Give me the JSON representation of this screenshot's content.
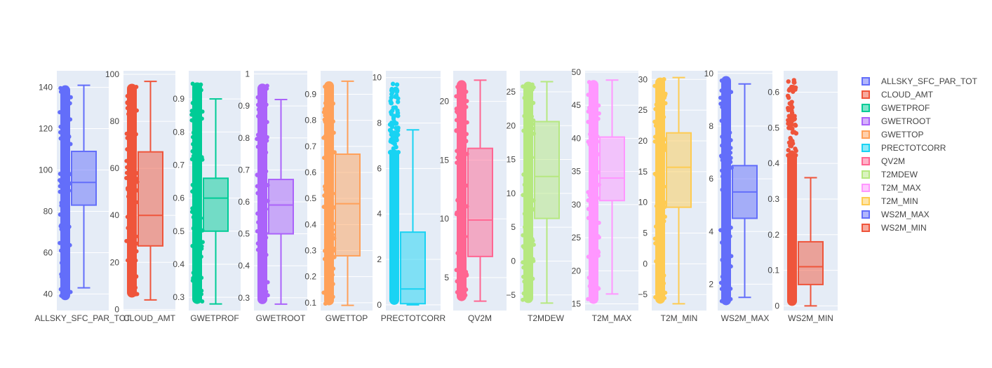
{
  "chart_data": {
    "type": "box",
    "grid": true,
    "legend_position": "right",
    "series": [
      {
        "name": "ALLSKY_SFC_PAR_TOT",
        "category": "ALLSKY_SFC_PAR_TOT",
        "color": "#636efa",
        "ylim": [
          32,
          148
        ],
        "ticks": [
          40,
          60,
          80,
          100,
          120,
          140
        ],
        "tick_labels": [
          "40",
          "60",
          "80",
          "100",
          "120",
          "140"
        ],
        "points_range": [
          37,
          141
        ],
        "points_density": "dense",
        "min": 43,
        "q1": 83,
        "median": 94,
        "q3": 109,
        "max": 141
      },
      {
        "name": "CLOUD_AMT",
        "category": "CLOUD_AMT",
        "color": "#ef553b",
        "ylim": [
          -0.5,
          101.5
        ],
        "ticks": [
          0,
          20,
          40,
          60,
          80,
          100
        ],
        "tick_labels": [
          "0",
          "20",
          "40",
          "60",
          "80",
          "100"
        ],
        "points_range": [
          5,
          96
        ],
        "points_density": "dense",
        "min": 4,
        "q1": 27,
        "median": 40,
        "q3": 67,
        "max": 97
      },
      {
        "name": "GWETPROF",
        "category": "GWETPROF",
        "color": "#00cc96",
        "ylim": [
          0.26,
          0.985
        ],
        "ticks": [
          0.3,
          0.4,
          0.5,
          0.6,
          0.7,
          0.8,
          0.9
        ],
        "tick_labels": [
          "0.3",
          "0.4",
          "0.5",
          "0.6",
          "0.7",
          "0.8",
          "0.9"
        ],
        "points_range": [
          0.28,
          0.95
        ],
        "points_density": "dense",
        "min": 0.28,
        "q1": 0.5,
        "median": 0.6,
        "q3": 0.66,
        "max": 0.9
      },
      {
        "name": "GWETROOT",
        "category": "GWETROOT",
        "color": "#ab63fa",
        "ylim": [
          0.26,
          1.01
        ],
        "ticks": [
          0.3,
          0.4,
          0.5,
          0.6,
          0.7,
          0.8,
          0.9,
          1
        ],
        "tick_labels": [
          "0.3",
          "0.4",
          "0.5",
          "0.6",
          "0.7",
          "0.8",
          "0.9",
          "1"
        ],
        "points_range": [
          0.28,
          0.97
        ],
        "points_density": "dense",
        "min": 0.28,
        "q1": 0.5,
        "median": 0.59,
        "q3": 0.67,
        "max": 0.92
      },
      {
        "name": "GWETTOP",
        "category": "GWETTOP",
        "color": "#ffa15a",
        "ylim": [
          0.07,
          0.99
        ],
        "ticks": [
          0.1,
          0.2,
          0.3,
          0.4,
          0.5,
          0.6,
          0.7,
          0.8,
          0.9
        ],
        "tick_labels": [
          "0.1",
          "0.2",
          "0.3",
          "0.4",
          "0.5",
          "0.6",
          "0.7",
          "0.8",
          "0.9"
        ],
        "points_range": [
          0.09,
          0.95
        ],
        "points_density": "dense",
        "min": 0.09,
        "q1": 0.28,
        "median": 0.48,
        "q3": 0.67,
        "max": 0.95
      },
      {
        "name": "PRECTOTCORR",
        "category": "PRECTOTCORR",
        "color": "#19d3f3",
        "ylim": [
          -0.25,
          10.3
        ],
        "ticks": [
          0,
          2,
          4,
          6,
          8,
          10
        ],
        "tick_labels": [
          "0",
          "2",
          "4",
          "6",
          "8",
          "10"
        ],
        "points_range": [
          0,
          9.8
        ],
        "points_density": "sparse-top",
        "min": 0,
        "q1": 0.05,
        "median": 0.7,
        "q3": 3.2,
        "max": 7.7
      },
      {
        "name": "QV2M",
        "category": "QV2M",
        "color": "#ff6692",
        "ylim": [
          2.2,
          22.6
        ],
        "ticks": [
          5,
          10,
          15,
          20
        ],
        "tick_labels": [
          "5",
          "10",
          "15",
          "20"
        ],
        "points_range": [
          3,
          21.8
        ],
        "points_density": "dense",
        "min": 3,
        "q1": 6.8,
        "median": 9.9,
        "q3": 16,
        "max": 21.8
      },
      {
        "name": "T2MDEW",
        "category": "T2MDEW",
        "color": "#b6e880",
        "ylim": [
          -7.3,
          28.1
        ],
        "ticks": [
          -5,
          0,
          5,
          10,
          15,
          20,
          25
        ],
        "tick_labels": [
          "−5",
          "0",
          "5",
          "10",
          "15",
          "20",
          "25"
        ],
        "points_range": [
          -6.2,
          26.5
        ],
        "points_density": "dense",
        "min": -6.2,
        "q1": 6.3,
        "median": 12.5,
        "q3": 20.6,
        "max": 26.5
      },
      {
        "name": "T2M_MAX",
        "category": "T2M_MAX",
        "color": "#ff97ff",
        "ylim": [
          14,
          50.2
        ],
        "ticks": [
          15,
          20,
          25,
          30,
          35,
          40,
          45,
          50
        ],
        "tick_labels": [
          "15",
          "20",
          "25",
          "30",
          "35",
          "40",
          "45",
          "50"
        ],
        "points_range": [
          15,
          48.8
        ],
        "points_density": "dense",
        "min": 16.5,
        "q1": 30.6,
        "median": 34,
        "q3": 40.2,
        "max": 48.8
      },
      {
        "name": "T2M_MIN",
        "category": "T2M_MIN",
        "color": "#fecb52",
        "ylim": [
          -7.6,
          31.4
        ],
        "ticks": [
          -5,
          0,
          5,
          10,
          15,
          20,
          25,
          30
        ],
        "tick_labels": [
          "−5",
          "0",
          "5",
          "10",
          "15",
          "20",
          "25",
          "30"
        ],
        "points_range": [
          -6.5,
          30.3
        ],
        "points_density": "dense",
        "min": -6.5,
        "q1": 9.2,
        "median": 15.7,
        "q3": 21.3,
        "max": 30.3
      },
      {
        "name": "WS2M_MAX",
        "category": "WS2M_MAX",
        "color": "#636efa",
        "ylim": [
          1,
          10.1
        ],
        "ticks": [
          2,
          4,
          6,
          8,
          10
        ],
        "tick_labels": [
          "2",
          "4",
          "6",
          "8",
          "10"
        ],
        "points_range": [
          1.2,
          9.9
        ],
        "points_density": "dense",
        "min": 1.5,
        "q1": 4.5,
        "median": 5.5,
        "q3": 6.5,
        "max": 9.6
      },
      {
        "name": "WS2M_MIN",
        "category": "WS2M_MIN",
        "color": "#ef553b",
        "ylim": [
          -0.013,
          0.66
        ],
        "ticks": [
          0,
          0.1,
          0.2,
          0.3,
          0.4,
          0.5,
          0.6
        ],
        "tick_labels": [
          "0",
          "0.1",
          "0.2",
          "0.3",
          "0.4",
          "0.5",
          "0.6"
        ],
        "points_range": [
          0,
          0.64
        ],
        "points_density": "sparse-top",
        "min": 0,
        "q1": 0.06,
        "median": 0.11,
        "q3": 0.18,
        "max": 0.36
      }
    ]
  }
}
